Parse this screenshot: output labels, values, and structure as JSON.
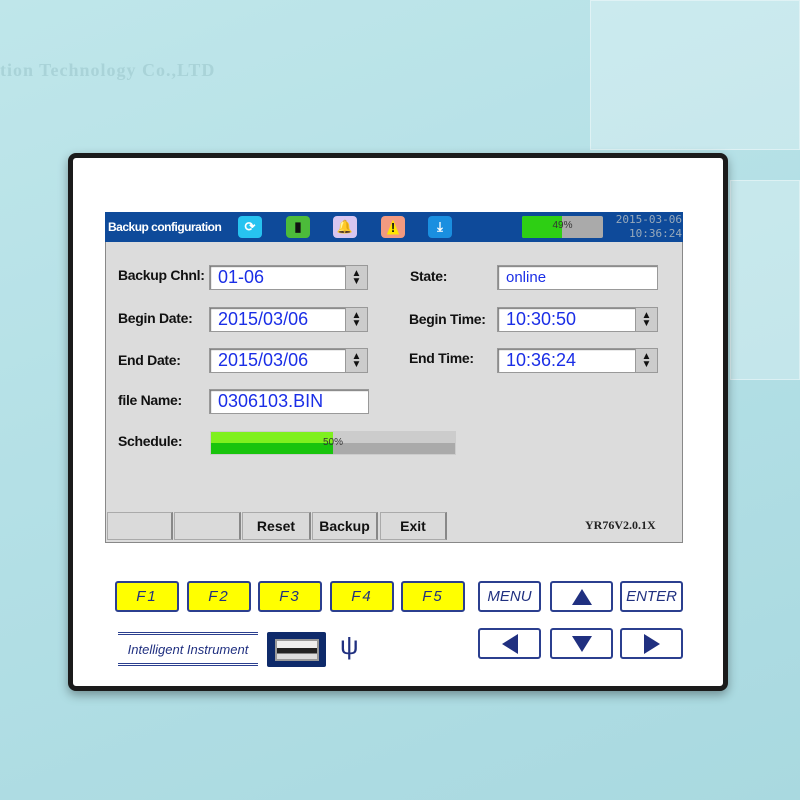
{
  "background": {
    "watermark": "tion Technology Co.,LTD"
  },
  "screen": {
    "title": "Backup configuration",
    "icons": [
      "refresh-icon",
      "usb-device-icon",
      "bell-icon",
      "warning-icon",
      "download-icon"
    ],
    "battery_label": "49%",
    "battery_percent": 49,
    "clock": {
      "date": "2015-03-06",
      "time": "10:36:24"
    },
    "form": {
      "backup_chnl_label": "Backup Chnl:",
      "backup_chnl_value": "01-06",
      "state_label": "State:",
      "state_value": "online",
      "begin_date_label": "Begin Date:",
      "begin_date_value": "2015/03/06",
      "begin_time_label": "Begin Time:",
      "begin_time_value": "10:30:50",
      "end_date_label": "End Date:",
      "end_date_value": "2015/03/06",
      "end_time_label": "End Time:",
      "end_time_value": "10:36:24",
      "file_name_label": "file Name:",
      "file_name_value": "0306103.BIN",
      "schedule_label": "Schedule:",
      "schedule_text": "50%",
      "schedule_percent": 50
    },
    "softkeys": [
      "",
      "",
      "Reset",
      "Backup",
      "Exit"
    ],
    "version": "YR76V2.0.1X"
  },
  "keypad": {
    "fkeys": [
      "F1",
      "F2",
      "F3",
      "F4",
      "F5"
    ],
    "menu": "MENU",
    "enter": "ENTER",
    "brand": "Intelligent Instrument"
  },
  "colors": {
    "titlebar": "#0e4a9a",
    "value_text": "#1a2ee6",
    "fkey": "#ffff00",
    "key_border": "#2b3f8f"
  }
}
